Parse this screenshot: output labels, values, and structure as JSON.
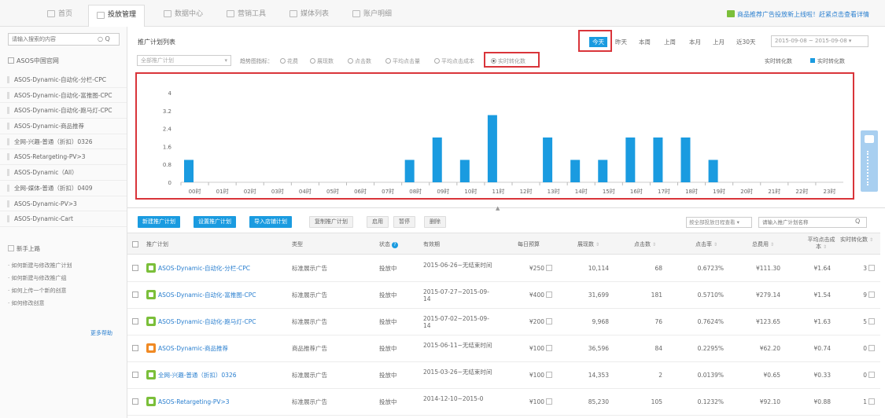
{
  "nav": {
    "tabs": [
      {
        "label": "首页"
      },
      {
        "label": "投放管理"
      },
      {
        "label": "数据中心"
      },
      {
        "label": "营销工具"
      },
      {
        "label": "媒体列表"
      },
      {
        "label": "账户明细"
      }
    ],
    "active_index": 1,
    "promo_text": "商品推荐广告投放新上线啦！赶紧点击查看详情"
  },
  "sidebar": {
    "search_placeholder": "请输入搜索的内容",
    "root_label": "ASOS中国官网",
    "items": [
      {
        "label": "ASOS-Dynamic-自动化-分栏-CPC"
      },
      {
        "label": "ASOS-Dynamic-自动化-富推图-CPC"
      },
      {
        "label": "ASOS-Dynamic-自动化-跑马灯-CPC"
      },
      {
        "label": "ASOS-Dynamic-商品推荐"
      },
      {
        "label": "全网-兴趣-普通（折扣）0326"
      },
      {
        "label": "ASOS-Retargeting-PV>3"
      },
      {
        "label": "ASOS-Dynamic（All）"
      },
      {
        "label": "全网-媒体-普通（折扣）0409"
      },
      {
        "label": "ASOS-Dynamic-PV>3"
      },
      {
        "label": "ASOS-Dynamic-Cart"
      }
    ],
    "guide_title": "新手上路",
    "guide_links": [
      {
        "label": "如何新建与修改推广计划"
      },
      {
        "label": "如何新建与修改推广组"
      },
      {
        "label": "如何上传一个新的创意"
      },
      {
        "label": "如何修改创意"
      }
    ],
    "more_help": "更多帮助"
  },
  "panel": {
    "title": "推广计划列表",
    "periods": [
      {
        "label": "今天"
      },
      {
        "label": "昨天"
      },
      {
        "label": "本周"
      },
      {
        "label": "上周"
      },
      {
        "label": "本月"
      },
      {
        "label": "上月"
      },
      {
        "label": "近30天"
      }
    ],
    "active_period": 0,
    "date_range": "2015-09-08 ~ 2015-09-08",
    "plan_select": "全部推广计划",
    "metric_label": "趋势图指标：",
    "metrics": [
      {
        "label": "花费"
      },
      {
        "label": "展现数"
      },
      {
        "label": "点击数"
      },
      {
        "label": "平均点击量"
      },
      {
        "label": "平均点击成本"
      },
      {
        "label": "实时转化数"
      }
    ],
    "selected_metric": 5,
    "legend_left": "实时转化数",
    "legend_right": "实时转化数"
  },
  "chart_data": {
    "type": "bar",
    "categories": [
      "00时",
      "01时",
      "02时",
      "03时",
      "04时",
      "05时",
      "06时",
      "07时",
      "08时",
      "09时",
      "10时",
      "11时",
      "12时",
      "13时",
      "14时",
      "15时",
      "16时",
      "17时",
      "18时",
      "19时",
      "20时",
      "21时",
      "22时",
      "23时"
    ],
    "values": [
      1,
      0,
      0,
      0,
      0,
      0,
      0,
      0,
      1,
      2,
      1,
      3,
      0,
      2,
      1,
      1,
      2,
      2,
      2,
      1,
      0,
      0,
      0,
      0
    ],
    "y_ticks": [
      "0",
      "0.8",
      "1.6",
      "2.4",
      "3.2",
      "4"
    ],
    "ylim": [
      0,
      4
    ],
    "color": "#1a9be0",
    "title": "",
    "xlabel": "",
    "ylabel": ""
  },
  "toolbar": {
    "buttons": [
      {
        "label": "新建推广计划",
        "style": "blue"
      },
      {
        "label": "设置推广计划",
        "style": "blue"
      },
      {
        "label": "导入店铺计划",
        "style": "blue"
      },
      {
        "label": "复制推广计划",
        "style": "grey"
      },
      {
        "label": "启用",
        "style": "grey"
      },
      {
        "label": "暂停",
        "style": "grey"
      },
      {
        "label": "删除",
        "style": "grey"
      }
    ],
    "filter_select": "按全部投放日程查看",
    "search_placeholder": "请输入推广计划名称"
  },
  "table": {
    "columns": [
      {
        "label": "推广计划"
      },
      {
        "label": "类型"
      },
      {
        "label": "状态"
      },
      {
        "label": "有效期"
      },
      {
        "label": "每日预算"
      },
      {
        "label": "展现数"
      },
      {
        "label": "点击数"
      },
      {
        "label": "点击率"
      },
      {
        "label": "总费用"
      },
      {
        "label": "平均点击成本"
      },
      {
        "label": "实时转化数"
      }
    ],
    "rows": [
      {
        "name": "ASOS-Dynamic-自动化-分栏-CPC",
        "icon": "green",
        "type": "标准展示广告",
        "status": "投放中",
        "period": "2015-06-26~无结束时间",
        "budget": "¥250",
        "impressions": "10,114",
        "clicks": "68",
        "ctr": "0.6723%",
        "cost": "¥111.30",
        "cpc": "¥1.64",
        "conv": "3"
      },
      {
        "name": "ASOS-Dynamic-自动化-富推图-CPC",
        "icon": "green",
        "type": "标准展示广告",
        "status": "投放中",
        "period": "2015-07-27~2015-09-14",
        "budget": "¥400",
        "impressions": "31,699",
        "clicks": "181",
        "ctr": "0.5710%",
        "cost": "¥279.14",
        "cpc": "¥1.54",
        "conv": "9"
      },
      {
        "name": "ASOS-Dynamic-自动化-跑马灯-CPC",
        "icon": "green",
        "type": "标准展示广告",
        "status": "投放中",
        "period": "2015-07-02~2015-09-14",
        "budget": "¥200",
        "impressions": "9,968",
        "clicks": "76",
        "ctr": "0.7624%",
        "cost": "¥123.65",
        "cpc": "¥1.63",
        "conv": "5"
      },
      {
        "name": "ASOS-Dynamic-商品推荐",
        "icon": "orange",
        "type": "商品推荐广告",
        "status": "投放中",
        "period": "2015-06-11~无结束时间",
        "budget": "¥100",
        "impressions": "36,596",
        "clicks": "84",
        "ctr": "0.2295%",
        "cost": "¥62.20",
        "cpc": "¥0.74",
        "conv": "0"
      },
      {
        "name": "全网-兴趣-普通（折扣）0326",
        "icon": "green",
        "type": "标准展示广告",
        "status": "投放中",
        "period": "2015-03-26~无结束时间",
        "budget": "¥100",
        "impressions": "14,353",
        "clicks": "2",
        "ctr": "0.0139%",
        "cost": "¥0.65",
        "cpc": "¥0.33",
        "conv": "0"
      },
      {
        "name": "ASOS-Retargeting-PV>3",
        "icon": "green",
        "type": "标准展示广告",
        "status": "投放中",
        "period": "2014-12-10~2015-0",
        "budget": "¥100",
        "impressions": "85,230",
        "clicks": "105",
        "ctr": "0.1232%",
        "cost": "¥92.10",
        "cpc": "¥0.88",
        "conv": "1"
      }
    ]
  }
}
